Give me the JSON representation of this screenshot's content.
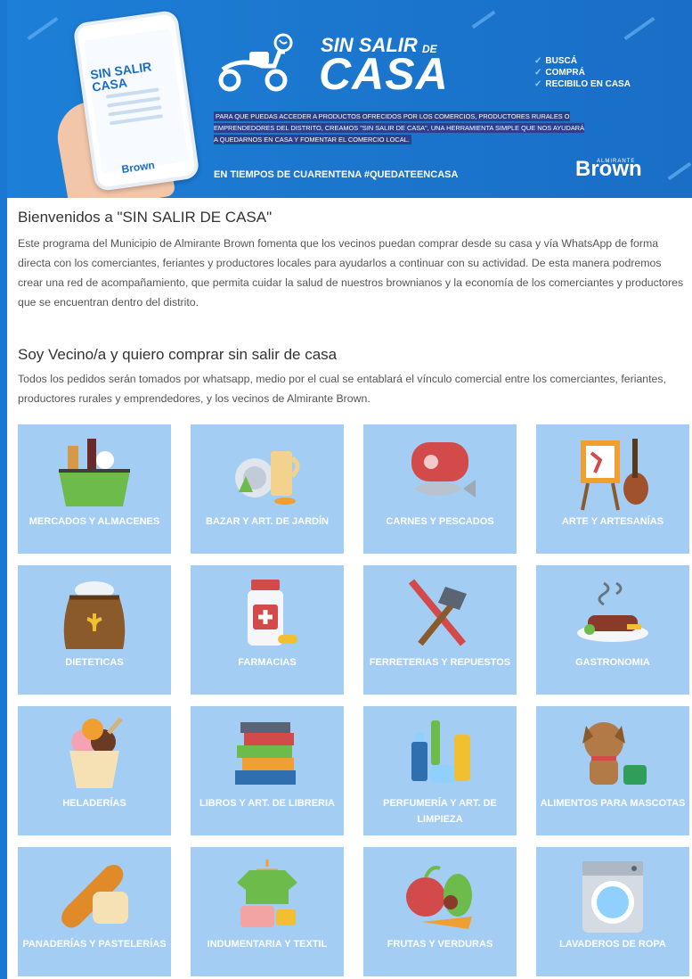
{
  "banner": {
    "phone_title": "SIN SALIR CASA",
    "phone_brand": "Brown",
    "sin_salir": "SIN SALIR",
    "de": "DE",
    "casa": "CASA",
    "checks": [
      "BUSCÁ",
      "COMPRÁ",
      "RECIBILO EN CASA"
    ],
    "description": "PARA QUE PUEDAS ACCEDER A PRODUCTOS OFRECIDOS POR LOS COMERCIOS, PRODUCTORES RURALES O EMPRENDEDORES DEL DISTRITO, CREAMOS \"SIN SALIR DE CASA\", UNA HERRAMIENTA SIMPLE QUE NOS AYUDARÁ A QUEDARNOS EN CASA Y FOMENTAR EL COMERCIO LOCAL.",
    "footer": "EN TIEMPOS DE CUARENTENA #QUEDATEENCASA",
    "logo_small": "ALMIRANTE",
    "logo_big": "Brown"
  },
  "intro": {
    "title": "Bienvenidos a \"SIN SALIR DE CASA\"",
    "text": "Este programa del Municipio de Almirante Brown fomenta que los vecinos puedan comprar desde su casa y vía WhatsApp de forma directa con los comerciantes, feriantes y productores locales para ayudarlos a continuar con su actividad. De esta manera podremos crear una red de acompañamiento, que permita cuidar la salud de nuestros brownianos y la economía de los comerciantes y productores que se encuentran dentro del distrito."
  },
  "section": {
    "title": "Soy Vecino/a y quiero comprar sin salir de casa",
    "text": "Todos los pedidos serán tomados por whatsapp, medio por el cual se entablará el vínculo comercial entre los comerciantes, feriantes, productores rurales y emprendedores, y los vecinos de Almirante Brown."
  },
  "categories": [
    {
      "label": "MERCADOS Y ALMACENES",
      "icon": "basket-icon"
    },
    {
      "label": "BAZAR Y ART. DE JARDÍN",
      "icon": "dishes-icon"
    },
    {
      "label": "CARNES Y PESCADOS",
      "icon": "meat-fish-icon"
    },
    {
      "label": "ARTE Y ARTESANÍAS",
      "icon": "easel-guitar-icon"
    },
    {
      "label": "DIETETICAS",
      "icon": "grain-sack-icon"
    },
    {
      "label": "FARMACIAS",
      "icon": "medicine-bottle-icon"
    },
    {
      "label": "FERRETERIAS Y REPUESTOS",
      "icon": "hammer-screwdriver-icon"
    },
    {
      "label": "GASTRONOMIA",
      "icon": "steak-plate-icon"
    },
    {
      "label": "HELADERÍAS",
      "icon": "ice-cream-icon"
    },
    {
      "label": "LIBROS Y ART. DE LIBRERIA",
      "icon": "books-icon"
    },
    {
      "label": "PERFUMERÍA Y ART. DE LIMPIEZA",
      "icon": "toiletries-icon"
    },
    {
      "label": "ALIMENTOS PARA MASCOTAS",
      "icon": "dog-icon"
    },
    {
      "label": "PANADERÍAS Y PASTELERÍAS",
      "icon": "bread-icon"
    },
    {
      "label": "INDUMENTARIA Y TEXTIL",
      "icon": "clothes-icon"
    },
    {
      "label": "FRUTAS Y VERDURAS",
      "icon": "fruits-vegetables-icon"
    },
    {
      "label": "LAVADEROS DE ROPA",
      "icon": "washing-machine-icon"
    }
  ]
}
